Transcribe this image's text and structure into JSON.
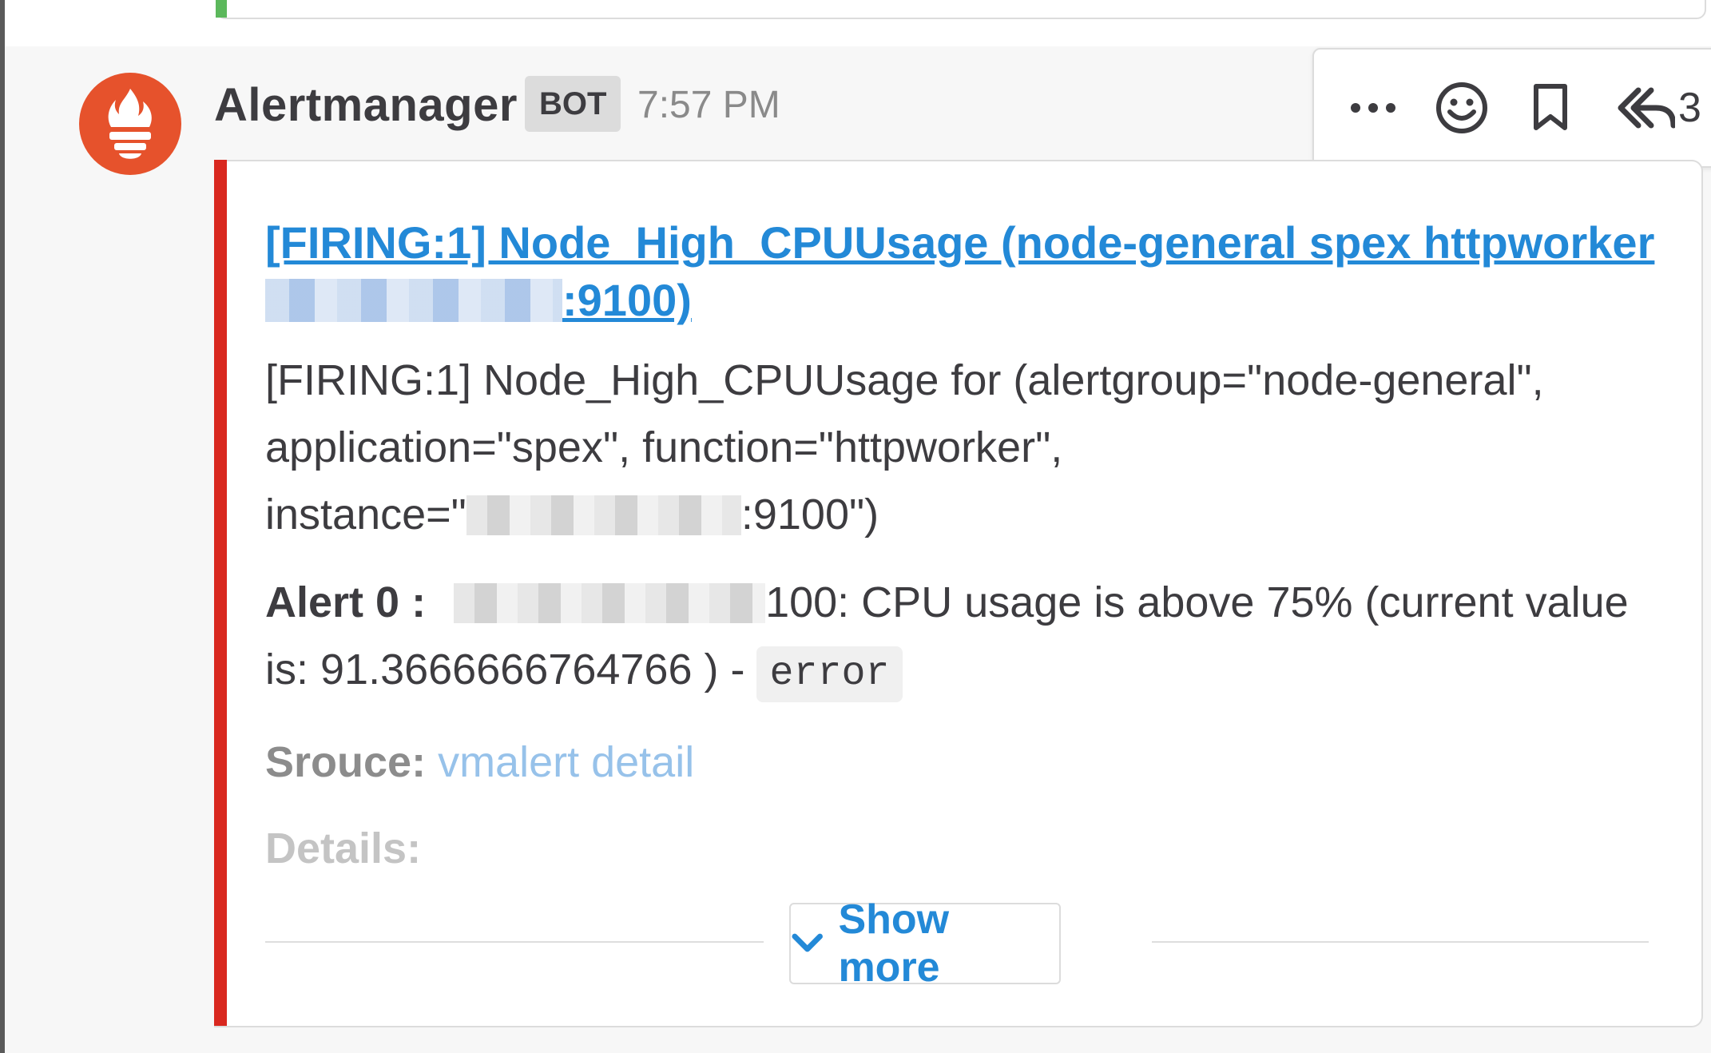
{
  "message": {
    "author": "Alertmanager",
    "bot_badge": "BOT",
    "timestamp": "7:57 PM",
    "avatar_icon": "prometheus-flame-icon"
  },
  "actions": {
    "more_icon": "more-dots-icon",
    "reaction_icon": "emoji-smile-icon",
    "save_icon": "bookmark-icon",
    "reply_icon": "reply-arrow-icon",
    "reply_count": "3"
  },
  "attachment": {
    "color": "#d9281f",
    "title_line1": "[FIRING:1] Node_High_CPUUsage (node-general spex httpworker",
    "title_line2_suffix": ":9100)",
    "body_line1": "[FIRING:1] Node_High_CPUUsage for  (alertgroup=\"node-general\",",
    "body_line2": "application=\"spex\", function=\"httpworker\",",
    "body_line3_prefix": "instance=\"",
    "body_line3_suffix": ":9100\")",
    "alert_label": "Alert 0 :",
    "alert_text_suffix": "100: CPU usage is above 75% (current value",
    "alert_value_line": "is: 91.3666666764766 ) -",
    "severity_code": "error",
    "source_label": "Srouce:",
    "source_link": "vmalert detail",
    "details_label": "Details:"
  },
  "show_more": {
    "label": "Show more",
    "icon": "chevron-down-icon"
  }
}
